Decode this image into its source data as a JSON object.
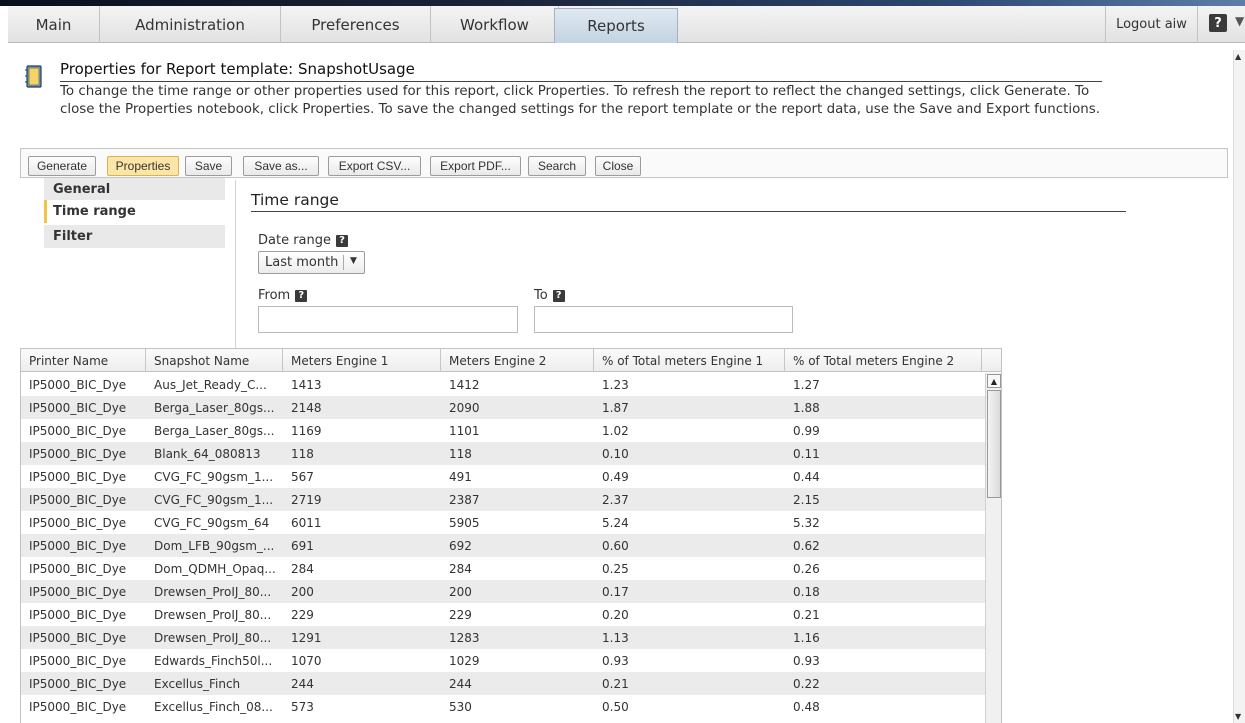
{
  "nav": {
    "tabs": [
      "Main",
      "Administration",
      "Preferences",
      "Workflow",
      "Reports"
    ],
    "active_tab": "Reports",
    "logout_label": "Logout aiw",
    "help_label": "?"
  },
  "header": {
    "title": "Properties for Report template: SnapshotUsage",
    "description": "To change the time range or other properties used for this report, click Properties. To refresh the report to reflect the changed settings, click Generate. To close the Properties notebook, click Properties. To save the changed settings for the report template or the report data, use the Save and Export functions."
  },
  "toolbar": {
    "generate": "Generate",
    "properties": "Properties",
    "save": "Save",
    "save_as": "Save as...",
    "export_csv": "Export CSV...",
    "export_pdf": "Export PDF...",
    "search": "Search",
    "close": "Close"
  },
  "sidebar": {
    "items": [
      "General",
      "Time range",
      "Filter"
    ],
    "active": "Time range"
  },
  "time_range": {
    "section_title": "Time range",
    "date_range_label": "Date range",
    "date_range_value": "Last month",
    "from_label": "From",
    "from_value": "",
    "to_label": "To",
    "to_value": ""
  },
  "table": {
    "columns": [
      "Printer Name",
      "Snapshot Name",
      "Meters Engine 1",
      "Meters Engine 2",
      "% of Total meters Engine 1",
      "% of Total meters Engine 2"
    ],
    "rows": [
      [
        "IP5000_BIC_Dye",
        "Aus_Jet_Ready_C...",
        "1413",
        "1412",
        "1.23",
        "1.27"
      ],
      [
        "IP5000_BIC_Dye",
        "Berga_Laser_80gs...",
        "2148",
        "2090",
        "1.87",
        "1.88"
      ],
      [
        "IP5000_BIC_Dye",
        "Berga_Laser_80gs...",
        "1169",
        "1101",
        "1.02",
        "0.99"
      ],
      [
        "IP5000_BIC_Dye",
        "Blank_64_080813",
        "118",
        "118",
        "0.10",
        "0.11"
      ],
      [
        "IP5000_BIC_Dye",
        "CVG_FC_90gsm_1...",
        "567",
        "491",
        "0.49",
        "0.44"
      ],
      [
        "IP5000_BIC_Dye",
        "CVG_FC_90gsm_1...",
        "2719",
        "2387",
        "2.37",
        "2.15"
      ],
      [
        "IP5000_BIC_Dye",
        "CVG_FC_90gsm_64",
        "6011",
        "5905",
        "5.24",
        "5.32"
      ],
      [
        "IP5000_BIC_Dye",
        "Dom_LFB_90gsm_...",
        "691",
        "692",
        "0.60",
        "0.62"
      ],
      [
        "IP5000_BIC_Dye",
        "Dom_QDMH_Opaq...",
        "284",
        "284",
        "0.25",
        "0.26"
      ],
      [
        "IP5000_BIC_Dye",
        "Drewsen_ProIJ_80...",
        "200",
        "200",
        "0.17",
        "0.18"
      ],
      [
        "IP5000_BIC_Dye",
        "Drewsen_ProIJ_80...",
        "229",
        "229",
        "0.20",
        "0.21"
      ],
      [
        "IP5000_BIC_Dye",
        "Drewsen_ProIJ_80...",
        "1291",
        "1283",
        "1.13",
        "1.16"
      ],
      [
        "IP5000_BIC_Dye",
        "Edwards_Finch50l...",
        "1070",
        "1029",
        "0.93",
        "0.93"
      ],
      [
        "IP5000_BIC_Dye",
        "Excellus_Finch",
        "244",
        "244",
        "0.21",
        "0.22"
      ],
      [
        "IP5000_BIC_Dye",
        "Excellus_Finch_08...",
        "573",
        "530",
        "0.50",
        "0.48"
      ]
    ]
  },
  "colors": {
    "accent_active_button": "#fbe6a6",
    "sidebar_active_marker": "#f0c34d",
    "active_tab": "#c4d3e1"
  }
}
